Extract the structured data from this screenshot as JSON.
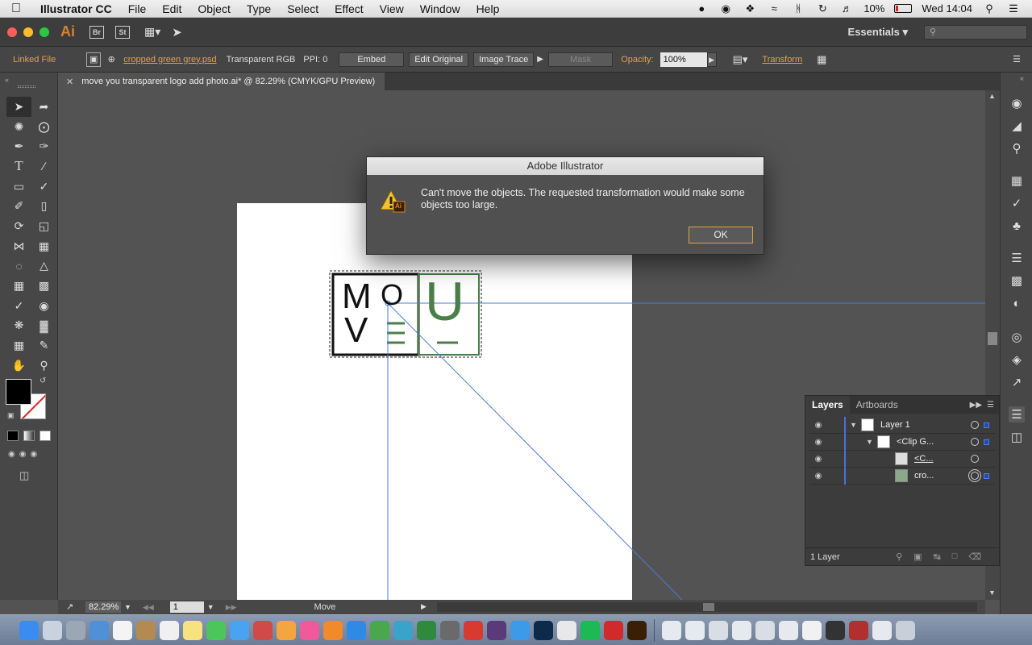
{
  "menubar": {
    "app_name": "Illustrator CC",
    "menus": [
      "File",
      "Edit",
      "Object",
      "Type",
      "Select",
      "Effect",
      "View",
      "Window",
      "Help"
    ],
    "battery": "10%",
    "clock": "Wed 14:04"
  },
  "appbar": {
    "logo": "Ai",
    "bridge": "Br",
    "stock": "St",
    "workspace": "Essentials"
  },
  "controlbar": {
    "linked_file": "Linked File",
    "file_name": "cropped green grey.psd",
    "color_mode": "Transparent RGB",
    "ppi": "PPI: 0",
    "embed": "Embed",
    "edit_original": "Edit Original",
    "image_trace": "Image Trace",
    "mask": "Mask",
    "opacity_label": "Opacity:",
    "opacity_value": "100%",
    "transform": "Transform"
  },
  "document": {
    "tab_title": "move you transparent logo add photo.ai* @ 82.29% (CMYK/GPU Preview)"
  },
  "artwork": {
    "letters": [
      "M",
      "O",
      "V",
      "U"
    ]
  },
  "status": {
    "zoom": "82.29%",
    "page": "1",
    "tool": "Move"
  },
  "dialog": {
    "title": "Adobe Illustrator",
    "message": "Can't move the objects. The requested transformation would make some objects too large.",
    "ok": "OK",
    "icon_badge": "Ai"
  },
  "layers": {
    "tab_layers": "Layers",
    "tab_artboards": "Artboards",
    "rows": [
      {
        "name": "Layer 1"
      },
      {
        "name": "<Clip G..."
      },
      {
        "name": "<C..."
      },
      {
        "name": "cro..."
      }
    ],
    "footer": "1 Layer"
  },
  "colors": {
    "accent_orange": "#e0a440",
    "guide_blue": "#4a7cd8",
    "logo_green": "#4a7f4a"
  }
}
